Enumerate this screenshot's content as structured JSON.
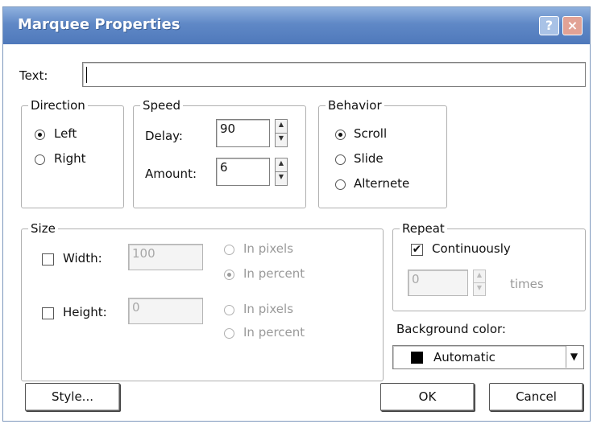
{
  "window": {
    "title": "Marquee Properties",
    "help_glyph": "?",
    "close_glyph": "×"
  },
  "text_field": {
    "label": "Text:",
    "value": ""
  },
  "direction": {
    "legend": "Direction",
    "left": "Left",
    "right": "Right",
    "selected": "Left"
  },
  "speed": {
    "legend": "Speed",
    "delay_label": "Delay:",
    "delay_value": "90",
    "amount_label": "Amount:",
    "amount_value": "6"
  },
  "behavior": {
    "legend": "Behavior",
    "scroll": "Scroll",
    "slide": "Slide",
    "alternate": "Alternete",
    "selected": "Scroll"
  },
  "size": {
    "legend": "Size",
    "width_label": "Width:",
    "width_value": "100",
    "width_pixels": "In pixels",
    "width_percent": "In percent",
    "height_label": "Height:",
    "height_value": "0",
    "height_pixels": "In pixels",
    "height_percent": "In percent"
  },
  "repeat": {
    "legend": "Repeat",
    "continuously_label": "Continuously",
    "continuously_checked": true,
    "check_glyph": "✔",
    "times_value": "0",
    "times_label": "times"
  },
  "background": {
    "label": "Background color:",
    "value": "Automatic",
    "swatch_color": "#000000",
    "arrow_glyph": "▼"
  },
  "buttons": {
    "style": "Style...",
    "ok": "OK",
    "cancel": "Cancel"
  },
  "spin_glyphs": {
    "up": "▲",
    "down": "▼"
  }
}
